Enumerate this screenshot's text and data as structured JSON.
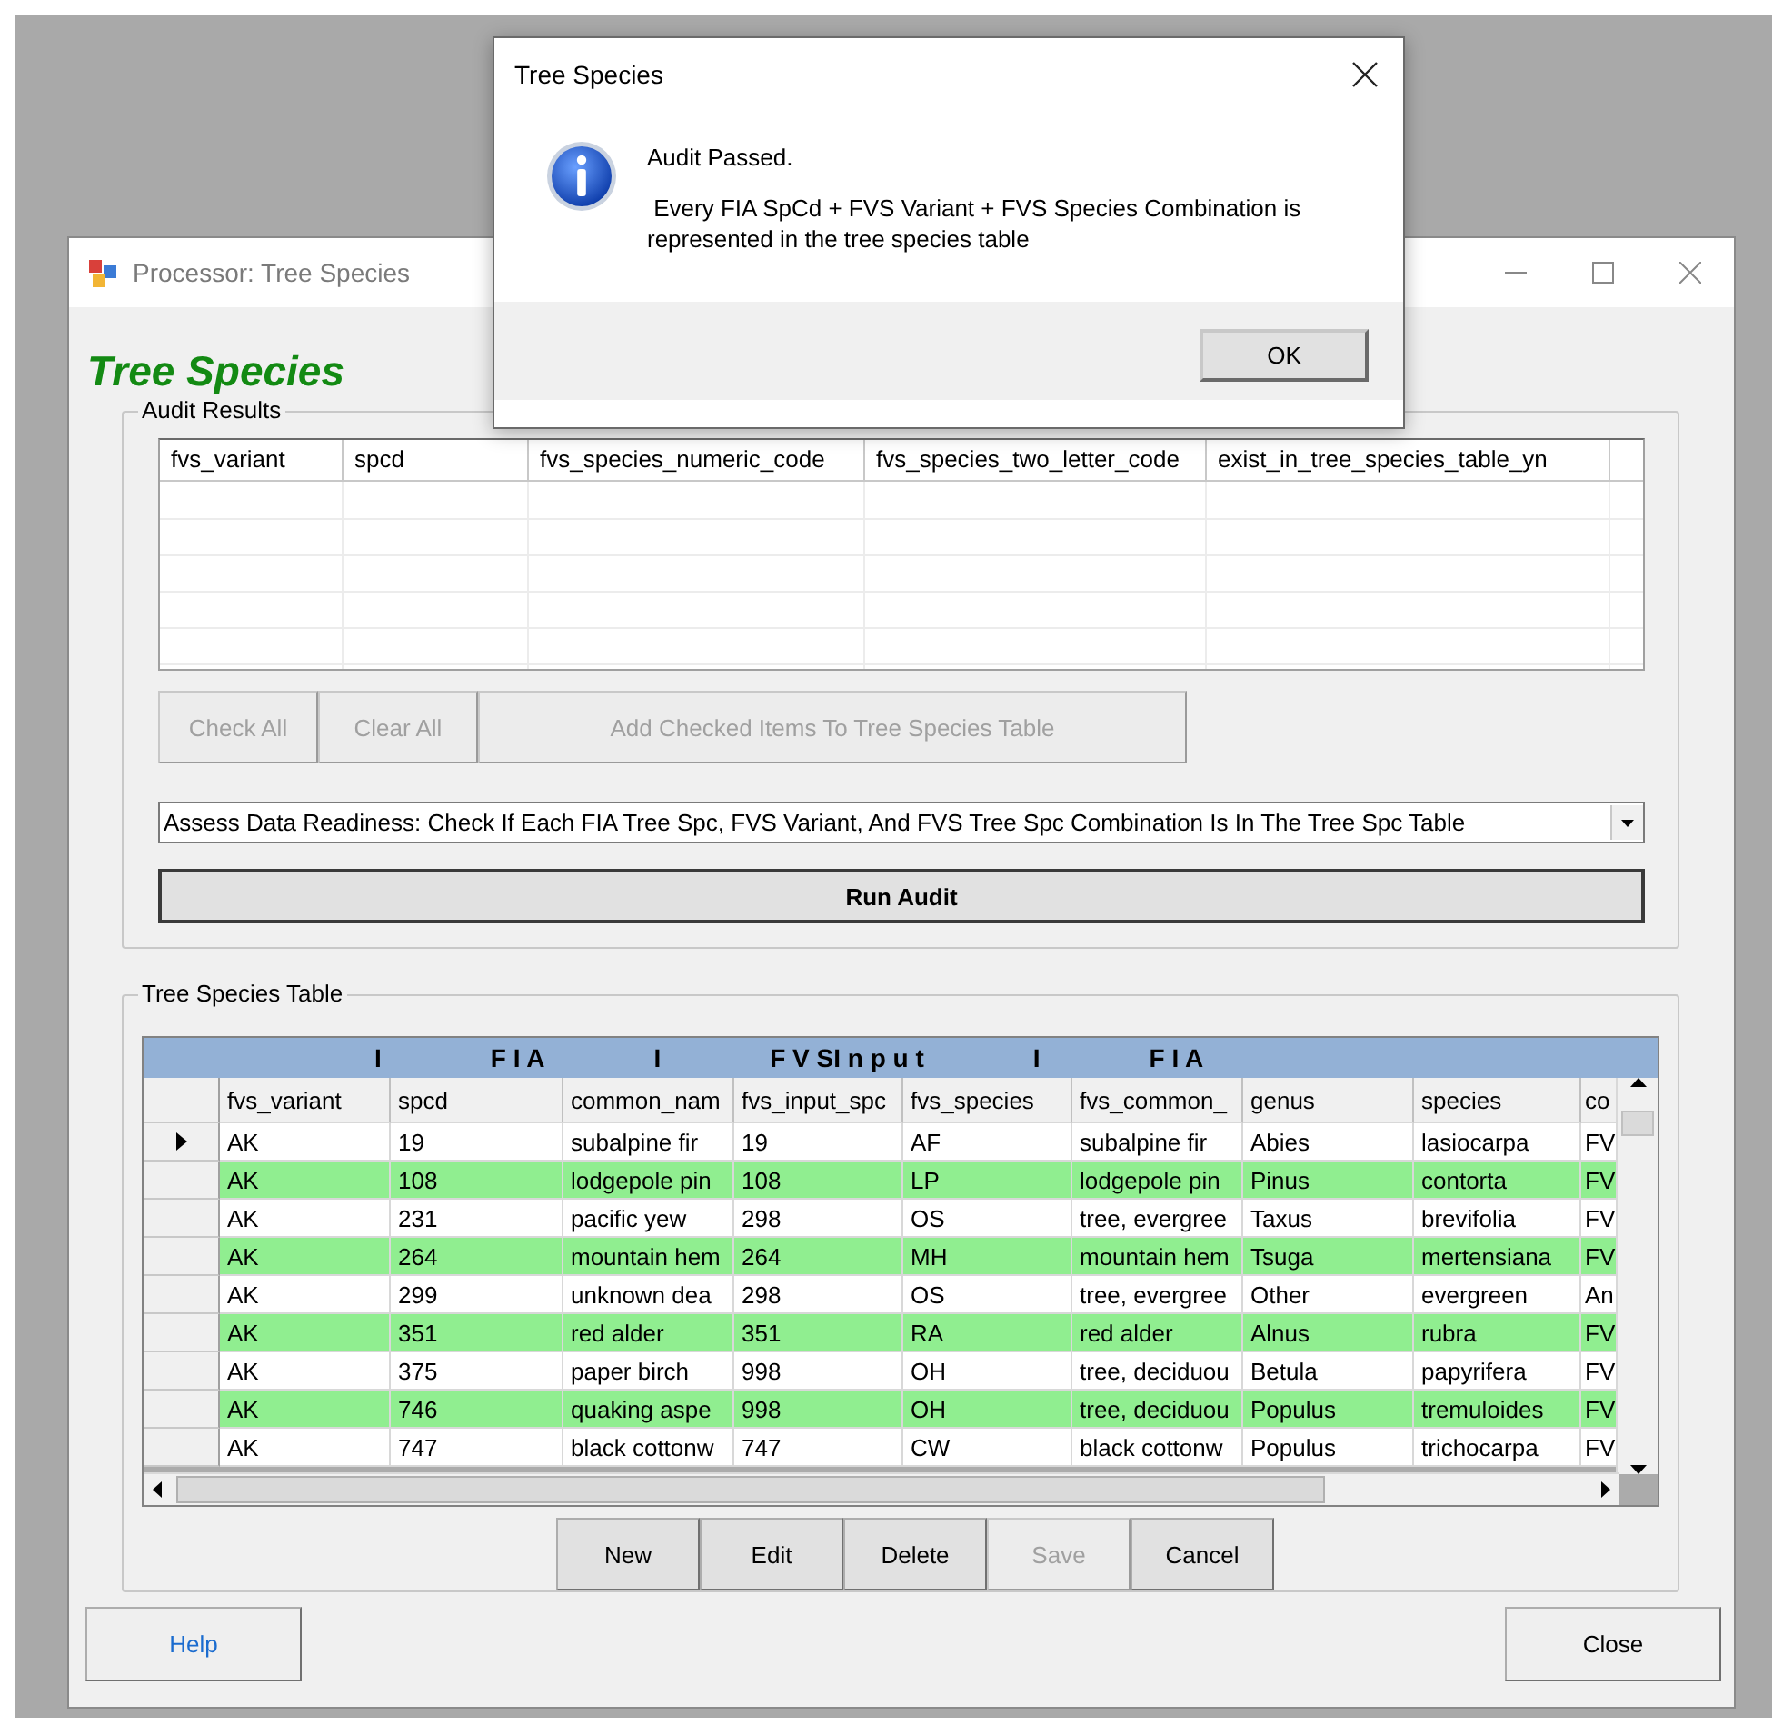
{
  "dialog": {
    "title": "Tree Species",
    "message_title": "Audit Passed.",
    "message_body": " Every FIA SpCd + FVS Variant + FVS Species Combination is represented in the tree species table",
    "ok_button": "OK"
  },
  "window": {
    "title": "Processor: Tree Species",
    "heading": "Tree Species"
  },
  "audit_results": {
    "label": "Audit Results",
    "columns": [
      "fvs_variant",
      "spcd",
      "fvs_species_numeric_code",
      "fvs_species_two_letter_code",
      "exist_in_tree_species_table_yn"
    ],
    "buttons": [
      {
        "label": "Check All",
        "disabled": true
      },
      {
        "label": "Clear All",
        "disabled": true
      },
      {
        "label": "Add Checked Items To Tree Species Table",
        "disabled": true
      }
    ],
    "audit_select": "Assess Data Readiness: Check If Each FIA Tree Spc, FVS Variant, And FVS Tree Spc Combination Is In The Tree Spc Table",
    "run_button": "Run Audit"
  },
  "tree_species_table": {
    "label": "Tree Species Table",
    "band": [
      "I",
      "F I A",
      "I",
      "F V SI n p u t",
      "I",
      "F I A"
    ],
    "columns": [
      "fvs_variant",
      "spcd",
      "common_nam",
      "fvs_input_spc",
      "fvs_species",
      "fvs_common_",
      "genus",
      "species",
      "co"
    ],
    "rows": [
      {
        "current": true,
        "highlighted": false,
        "cells": [
          "AK",
          "19",
          "subalpine fir",
          "19",
          "AF",
          "subalpine fir",
          "Abies",
          "lasiocarpa",
          "FV"
        ]
      },
      {
        "current": false,
        "highlighted": true,
        "cells": [
          "AK",
          "108",
          "lodgepole pin",
          "108",
          "LP",
          "lodgepole pin",
          "Pinus",
          "contorta",
          "FV"
        ]
      },
      {
        "current": false,
        "highlighted": false,
        "cells": [
          "AK",
          "231",
          "pacific yew",
          "298",
          "OS",
          "tree, evergree",
          "Taxus",
          "brevifolia",
          "FV"
        ]
      },
      {
        "current": false,
        "highlighted": true,
        "cells": [
          "AK",
          "264",
          "mountain hem",
          "264",
          "MH",
          "mountain hem",
          "Tsuga",
          "mertensiana",
          "FV"
        ]
      },
      {
        "current": false,
        "highlighted": false,
        "cells": [
          "AK",
          "299",
          "unknown dea",
          "298",
          "OS",
          "tree, evergree",
          "Other",
          "evergreen",
          "An"
        ]
      },
      {
        "current": false,
        "highlighted": true,
        "cells": [
          "AK",
          "351",
          "red alder",
          "351",
          "RA",
          "red alder",
          "Alnus",
          "rubra",
          "FV"
        ]
      },
      {
        "current": false,
        "highlighted": false,
        "cells": [
          "AK",
          "375",
          "paper birch",
          "998",
          "OH",
          "tree, deciduou",
          "Betula",
          "papyrifera",
          "FV"
        ]
      },
      {
        "current": false,
        "highlighted": true,
        "cells": [
          "AK",
          "746",
          "quaking aspe",
          "998",
          "OH",
          "tree, deciduou",
          "Populus",
          "tremuloides",
          "FV"
        ]
      },
      {
        "current": false,
        "highlighted": false,
        "cells": [
          "AK",
          "747",
          "black cottonw",
          "747",
          "CW",
          "black cottonw",
          "Populus",
          "trichocarpa",
          "FV"
        ]
      }
    ],
    "buttons": [
      {
        "label": "New",
        "disabled": false
      },
      {
        "label": "Edit",
        "disabled": false
      },
      {
        "label": "Delete",
        "disabled": false
      },
      {
        "label": "Save",
        "disabled": true
      },
      {
        "label": "Cancel",
        "disabled": false
      }
    ]
  },
  "footer": {
    "help_button": "Help",
    "close_button": "Close"
  }
}
